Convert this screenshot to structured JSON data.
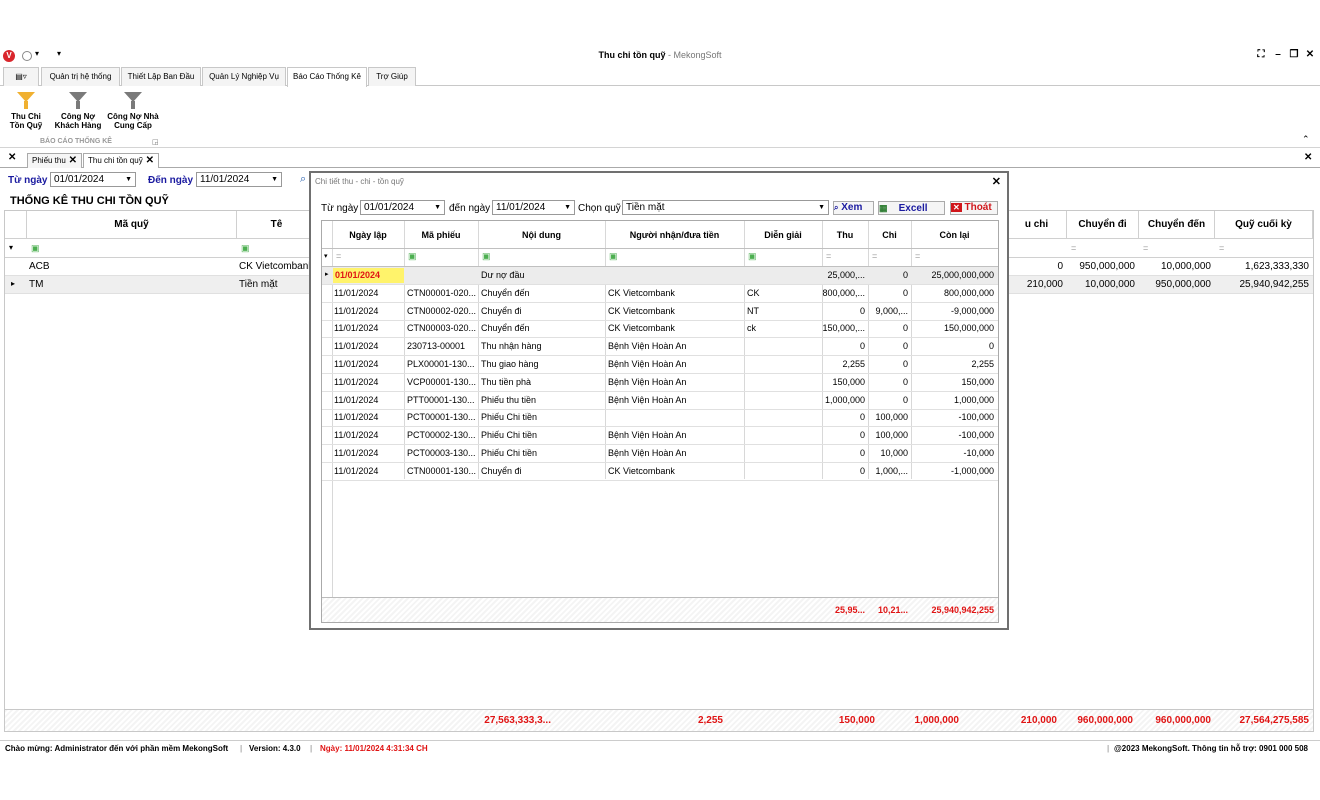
{
  "window": {
    "title": "Thu chi tồn quỹ",
    "app_name": "MekongSoft",
    "logo_letter": "V"
  },
  "ribbon": {
    "tabs": [
      "Quản trị hệ thống",
      "Thiết Lập Ban Đầu",
      "Quản Lý Nghiệp Vụ",
      "Báo Cáo Thống Kê",
      "Trợ Giúp"
    ],
    "active_tab": "Báo Cáo Thống Kê",
    "buttons": [
      {
        "line1": "Thu Chi",
        "line2": "Tồn Quỹ"
      },
      {
        "line1": "Công Nợ",
        "line2": "Khách Hàng"
      },
      {
        "line1": "Công Nợ Nhà",
        "line2": "Cung Cấp"
      }
    ],
    "group_label": "BÁO CÁO THỐNG KÊ"
  },
  "doc_tabs": [
    "Phiếu thu",
    "Thu chi tồn quỹ"
  ],
  "filter": {
    "from_label": "Từ ngày",
    "from_value": "01/01/2024",
    "to_label": "Đến ngày",
    "to_value": "11/01/2024"
  },
  "report": {
    "heading": "THỐNG KÊ THU CHI TỒN QUỸ",
    "columns": {
      "ma_quy": "Mã quỹ",
      "ten": "Tê",
      "tong_chi": "u chi",
      "chuyen_di": "Chuyển đi",
      "chuyen_den": "Chuyển đến",
      "quy_cuoi_ky": "Quỹ cuối kỳ"
    },
    "rows": [
      {
        "ma_quy": "ACB",
        "ten": "CK Vietcombank",
        "tong_chi": "0",
        "chuyen_di": "950,000,000",
        "chuyen_den": "10,000,000",
        "quy_cuoi_ky": "1,623,333,330"
      },
      {
        "ma_quy": "TM",
        "ten": "Tiền mặt",
        "tong_chi": "210,000",
        "chuyen_di": "10,000,000",
        "chuyen_den": "950,000,000",
        "quy_cuoi_ky": "25,940,942,255"
      }
    ],
    "totals": [
      "27,563,333,3...",
      "2,255",
      "150,000",
      "1,000,000",
      "210,000",
      "960,000,000",
      "960,000,000",
      "27,564,275,585"
    ]
  },
  "detail": {
    "title": "Chi tiết thu - chi - tồn quỹ",
    "from_label": "Từ ngày",
    "from_value": "01/01/2024",
    "to_label": "đến ngày",
    "to_value": "11/01/2024",
    "fund_label": "Chọn quỹ",
    "fund_value": "Tiền mặt",
    "view_btn": "Xem",
    "excel_btn": "Excell",
    "exit_btn": "Thoát",
    "columns": {
      "ngay_lap": "Ngày lập",
      "ma_phieu": "Mã phiếu",
      "noi_dung": "Nội dung",
      "nguoi": "Người nhận/đưa tiền",
      "dien_giai": "Diễn giải",
      "thu": "Thu",
      "chi": "Chi",
      "con_lai": "Còn lại"
    },
    "rows": [
      {
        "ngay_lap": "01/01/2024",
        "ma_phieu": "",
        "noi_dung": "Dư nợ đầu",
        "nguoi": "",
        "dien_giai": "",
        "thu": "25,000,...",
        "chi": "0",
        "con_lai": "25,000,000,000"
      },
      {
        "ngay_lap": "11/01/2024",
        "ma_phieu": "CTN00001-020...",
        "noi_dung": "Chuyển đến",
        "nguoi": "CK Vietcombank",
        "dien_giai": "CK",
        "thu": "800,000,...",
        "chi": "0",
        "con_lai": "800,000,000"
      },
      {
        "ngay_lap": "11/01/2024",
        "ma_phieu": "CTN00002-020...",
        "noi_dung": "Chuyển đi",
        "nguoi": "CK Vietcombank",
        "dien_giai": "NT",
        "thu": "0",
        "chi": "9,000,...",
        "con_lai": "-9,000,000"
      },
      {
        "ngay_lap": "11/01/2024",
        "ma_phieu": "CTN00003-020...",
        "noi_dung": "Chuyển đến",
        "nguoi": "CK Vietcombank",
        "dien_giai": "ck",
        "thu": "150,000,...",
        "chi": "0",
        "con_lai": "150,000,000"
      },
      {
        "ngay_lap": "11/01/2024",
        "ma_phieu": "230713-00001",
        "noi_dung": "Thu nhận hàng",
        "nguoi": "Bệnh Viện Hoàn An",
        "dien_giai": "",
        "thu": "0",
        "chi": "0",
        "con_lai": "0"
      },
      {
        "ngay_lap": "11/01/2024",
        "ma_phieu": "PLX00001-130...",
        "noi_dung": "Thu giao hàng",
        "nguoi": "Bệnh Viện Hoàn An",
        "dien_giai": "",
        "thu": "2,255",
        "chi": "0",
        "con_lai": "2,255"
      },
      {
        "ngay_lap": "11/01/2024",
        "ma_phieu": "VCP00001-130...",
        "noi_dung": "Thu tiền phà",
        "nguoi": "Bệnh Viện Hoàn An",
        "dien_giai": "",
        "thu": "150,000",
        "chi": "0",
        "con_lai": "150,000"
      },
      {
        "ngay_lap": "11/01/2024",
        "ma_phieu": "PTT00001-130...",
        "noi_dung": "Phiếu thu tiền",
        "nguoi": "Bệnh Viện Hoàn An",
        "dien_giai": "",
        "thu": "1,000,000",
        "chi": "0",
        "con_lai": "1,000,000"
      },
      {
        "ngay_lap": "11/01/2024",
        "ma_phieu": "PCT00001-130...",
        "noi_dung": "Phiếu Chi tiền",
        "nguoi": "",
        "dien_giai": "",
        "thu": "0",
        "chi": "100,000",
        "con_lai": "-100,000"
      },
      {
        "ngay_lap": "11/01/2024",
        "ma_phieu": "PCT00002-130...",
        "noi_dung": "Phiếu Chi tiền",
        "nguoi": "Bệnh Viện Hoàn An",
        "dien_giai": "",
        "thu": "0",
        "chi": "100,000",
        "con_lai": "-100,000"
      },
      {
        "ngay_lap": "11/01/2024",
        "ma_phieu": "PCT00003-130...",
        "noi_dung": "Phiếu Chi tiền",
        "nguoi": "Bệnh Viện Hoàn An",
        "dien_giai": "",
        "thu": "0",
        "chi": "10,000",
        "con_lai": "-10,000"
      },
      {
        "ngay_lap": "11/01/2024",
        "ma_phieu": "CTN00001-130...",
        "noi_dung": "Chuyển đi",
        "nguoi": "CK Vietcombank",
        "dien_giai": "",
        "thu": "0",
        "chi": "1,000,...",
        "con_lai": "-1,000,000"
      }
    ],
    "totals": {
      "thu": "25,95...",
      "chi": "10,21...",
      "con_lai": "25,940,942,255"
    }
  },
  "status": {
    "welcome": "Chào mừng: Administrator đến với phần mềm MekongSoft",
    "version": "Version: 4.3.0",
    "date": "Ngày: 11/01/2024 4:31:34 CH",
    "copyright": "@2023 MekongSoft. Thông tin hỗ trợ: 0901 000 508"
  }
}
